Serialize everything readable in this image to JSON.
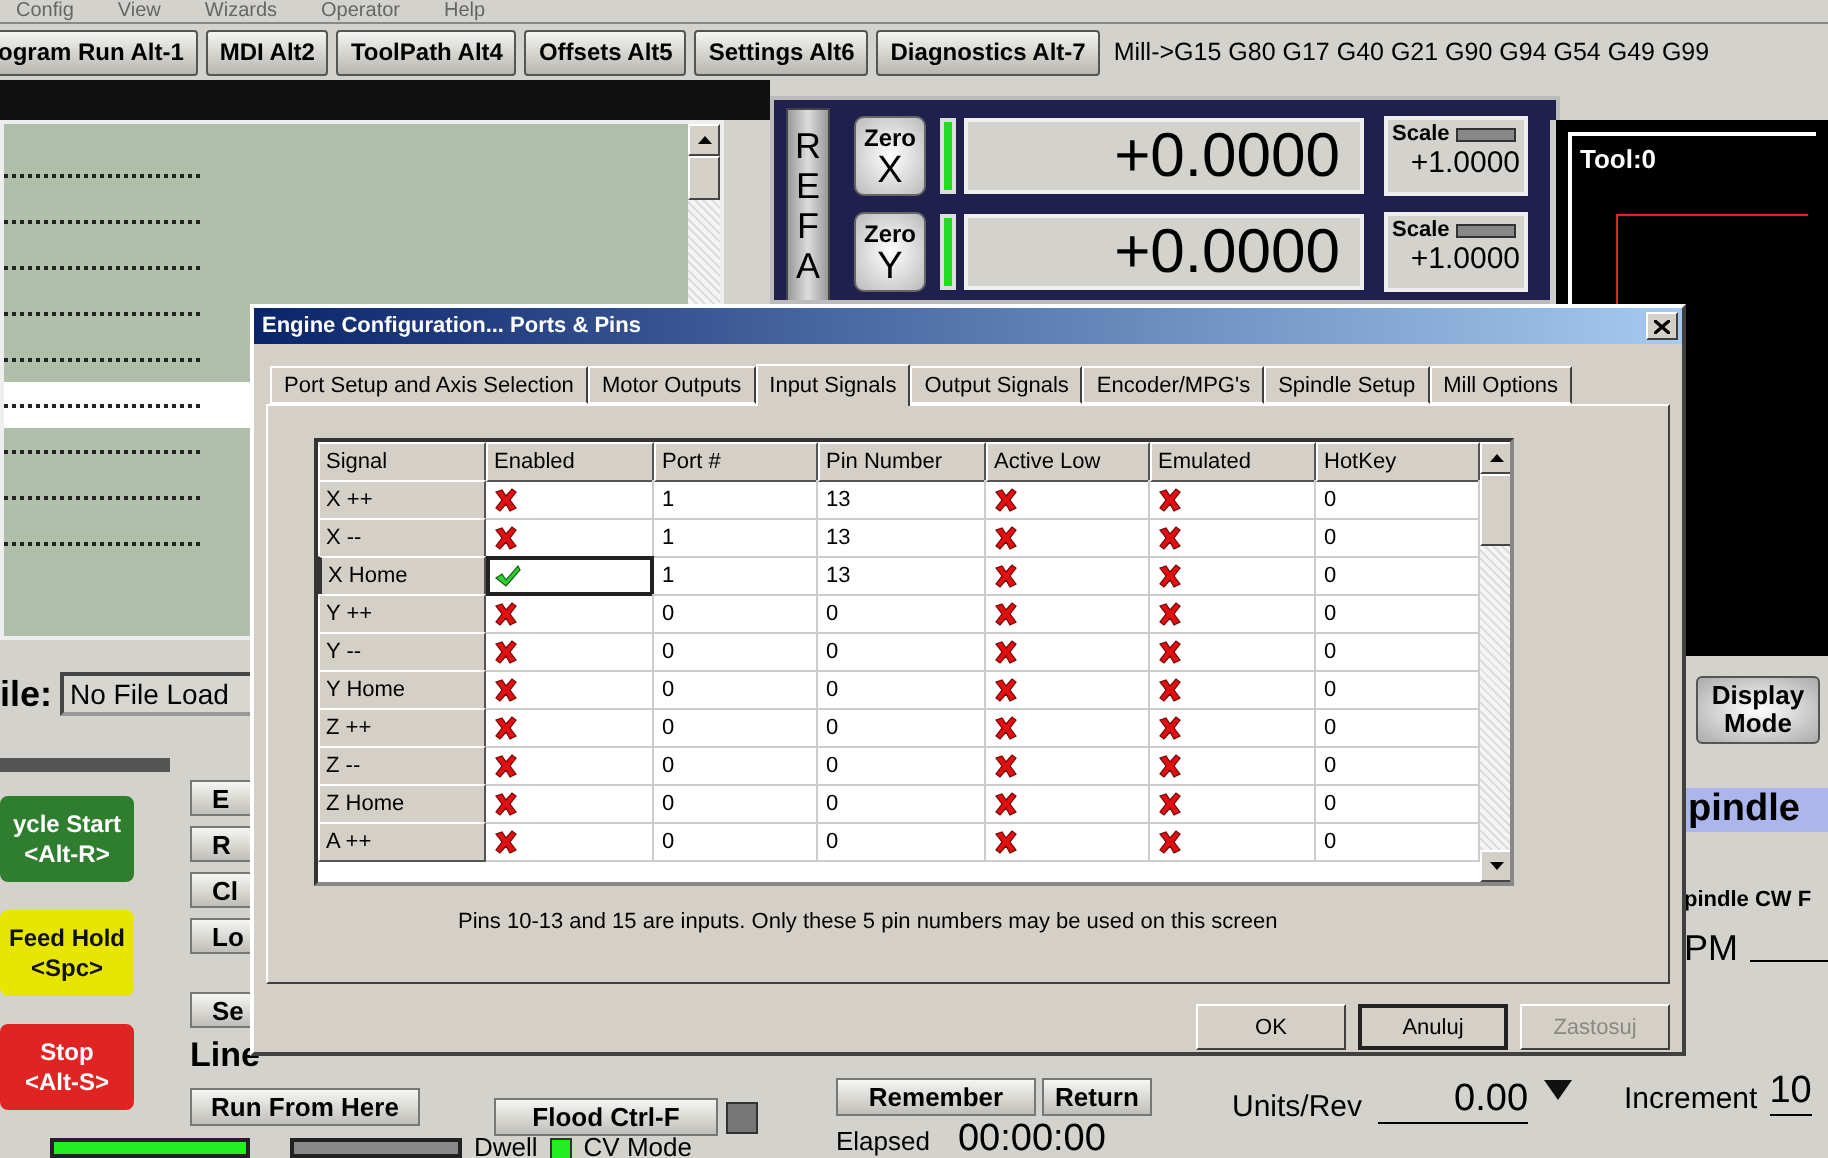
{
  "menu": [
    "Config",
    "View",
    "Wizards",
    "Operator",
    "Help"
  ],
  "screen_tabs": [
    "ogram Run Alt-1",
    "MDI Alt2",
    "ToolPath Alt4",
    "Offsets Alt5",
    "Settings Alt6",
    "Diagnostics Alt-7"
  ],
  "modal_line": "Mill->G15  G80 G17 G40 G21 G90 G94 G54 G49 G99",
  "gcode_lines": [
    {
      "selected": false
    },
    {
      "selected": false
    },
    {
      "selected": false
    },
    {
      "selected": false
    },
    {
      "selected": false
    },
    {
      "selected": true
    },
    {
      "selected": false
    },
    {
      "selected": false
    },
    {
      "selected": false
    }
  ],
  "file": {
    "label": "ile:",
    "value": "No File Load"
  },
  "cycle_buttons": [
    {
      "label": "ycle Start",
      "hotkey": "<Alt-R>",
      "color": "#2f7d2f"
    },
    {
      "label": "Feed Hold",
      "hotkey": "<Spc>",
      "color": "#e6e600"
    },
    {
      "label": "Stop",
      "hotkey": "<Alt-S>",
      "color": "#e02424"
    }
  ],
  "small_buttons": [
    "E",
    "R",
    "Cl",
    "Lo"
  ],
  "set_button": "Se",
  "line_label": "Line",
  "run_from_here": "Run From Here",
  "flood": "Flood Ctrl-F",
  "status": {
    "dwell": "Dwell",
    "cv_mode": "CV Mode",
    "cv_mode_on": true
  },
  "dro": {
    "ref_all": "REF A",
    "axes": [
      {
        "zero": "Zero",
        "axis": "X",
        "value": "+0.0000",
        "scale_label": "Scale",
        "scale": "+1.0000"
      },
      {
        "zero": "Zero",
        "axis": "Y",
        "value": "+0.0000",
        "scale_label": "Scale",
        "scale": "+1.0000"
      }
    ]
  },
  "toolpath": {
    "label": "Tool:0"
  },
  "display_mode": "Display Mode",
  "spindle": {
    "title": "pindle",
    "cw": "pindle CW F",
    "rpm_label": "PM"
  },
  "remember": "Remember",
  "return": "Return",
  "units_rev": {
    "label": "Units/Rev",
    "value": "0.00"
  },
  "increment": {
    "label": "Increment",
    "value": "10"
  },
  "elapsed": {
    "label": "Elapsed",
    "value": "00:00:00"
  },
  "dialog": {
    "title": "Engine Configuration... Ports & Pins",
    "tabs": [
      {
        "label": "Port Setup and Axis Selection",
        "selected": false
      },
      {
        "label": "Motor Outputs",
        "selected": false
      },
      {
        "label": "Input Signals",
        "selected": true
      },
      {
        "label": "Output Signals",
        "selected": false
      },
      {
        "label": "Encoder/MPG's",
        "selected": false
      },
      {
        "label": "Spindle Setup",
        "selected": false
      },
      {
        "label": "Mill Options",
        "selected": false
      }
    ],
    "columns": [
      "Signal",
      "Enabled",
      "Port #",
      "Pin Number",
      "Active Low",
      "Emulated",
      "HotKey"
    ],
    "rows": [
      {
        "signal": "X ++",
        "enabled": false,
        "port": "1",
        "pin": "13",
        "active_low": false,
        "emulated": false,
        "hotkey": "0",
        "selected": false
      },
      {
        "signal": "X --",
        "enabled": false,
        "port": "1",
        "pin": "13",
        "active_low": false,
        "emulated": false,
        "hotkey": "0",
        "selected": false
      },
      {
        "signal": "X Home",
        "enabled": true,
        "port": "1",
        "pin": "13",
        "active_low": false,
        "emulated": false,
        "hotkey": "0",
        "selected": true
      },
      {
        "signal": "Y ++",
        "enabled": false,
        "port": "0",
        "pin": "0",
        "active_low": false,
        "emulated": false,
        "hotkey": "0",
        "selected": false
      },
      {
        "signal": "Y --",
        "enabled": false,
        "port": "0",
        "pin": "0",
        "active_low": false,
        "emulated": false,
        "hotkey": "0",
        "selected": false
      },
      {
        "signal": "Y Home",
        "enabled": false,
        "port": "0",
        "pin": "0",
        "active_low": false,
        "emulated": false,
        "hotkey": "0",
        "selected": false
      },
      {
        "signal": "Z ++",
        "enabled": false,
        "port": "0",
        "pin": "0",
        "active_low": false,
        "emulated": false,
        "hotkey": "0",
        "selected": false
      },
      {
        "signal": "Z --",
        "enabled": false,
        "port": "0",
        "pin": "0",
        "active_low": false,
        "emulated": false,
        "hotkey": "0",
        "selected": false
      },
      {
        "signal": "Z Home",
        "enabled": false,
        "port": "0",
        "pin": "0",
        "active_low": false,
        "emulated": false,
        "hotkey": "0",
        "selected": false
      },
      {
        "signal": "A ++",
        "enabled": false,
        "port": "0",
        "pin": "0",
        "active_low": false,
        "emulated": false,
        "hotkey": "0",
        "selected": false
      }
    ],
    "note": "Pins 10-13 and 15 are inputs. Only these 5 pin numbers may be used on this screen",
    "buttons": [
      {
        "label": "OK",
        "focused": false,
        "disabled": false
      },
      {
        "label": "Anuluj",
        "focused": true,
        "disabled": false
      },
      {
        "label": "Zastosuj",
        "focused": false,
        "disabled": true
      }
    ]
  }
}
